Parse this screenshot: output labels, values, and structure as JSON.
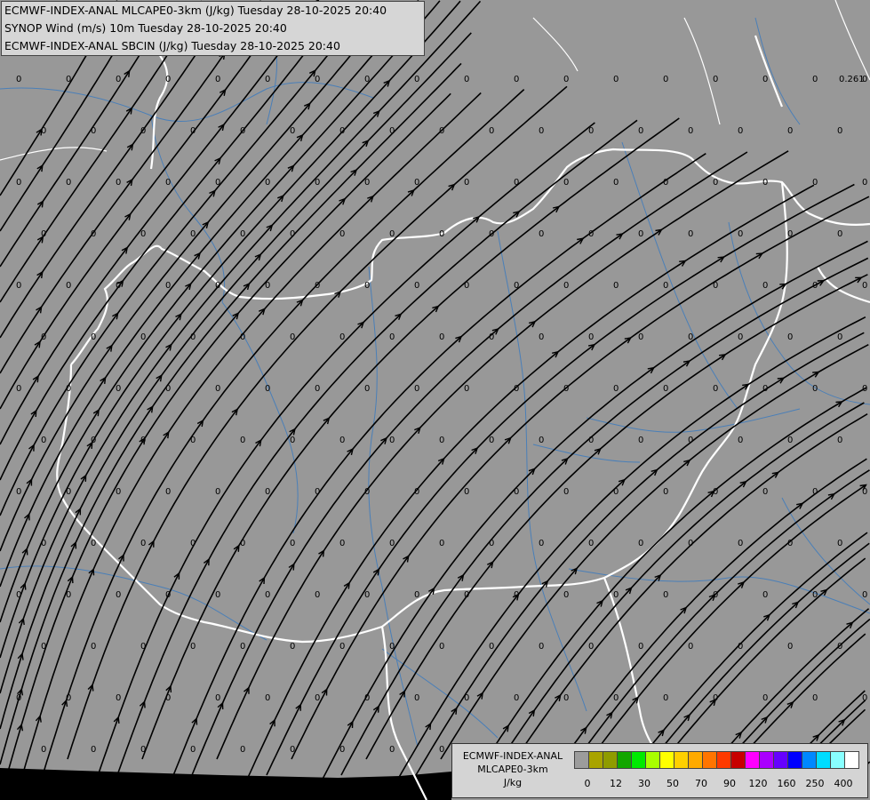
{
  "header": {
    "line1": "ECMWF-INDEX-ANAL MLCAPE0-3km (J/kg) Tuesday 28-10-2025 20:40",
    "line2": "SYNOP Wind (m/s) 10m Tuesday 28-10-2025 20:40",
    "line3": "ECMWF-INDEX-ANAL SBCIN (J/kg) Tuesday 28-10-2025 20:40"
  },
  "legend": {
    "label_line1": "ECMWF-INDEX-ANAL",
    "label_line2": "MLCAPE0-3km",
    "label_line3": "J/kg",
    "colors": [
      "#9c9c9c",
      "#a9a400",
      "#8f9c00",
      "#12a600",
      "#00ea00",
      "#a9ff00",
      "#ffff00",
      "#ffd000",
      "#ffaa00",
      "#ff7500",
      "#ff3a00",
      "#c80000",
      "#ff00ff",
      "#aa00ff",
      "#6600ff",
      "#0000ff",
      "#0088ff",
      "#00ddff",
      "#88ffff",
      "#ffffff"
    ],
    "ticks": [
      "0",
      "12",
      "30",
      "50",
      "70",
      "90",
      "120",
      "160",
      "250",
      "400"
    ]
  },
  "map": {
    "grid_value": "0",
    "special_value": "0.261",
    "background_color": "#989898",
    "border_color": "#ffffff",
    "river_color": "#4a7fb8",
    "streamline_color": "#000000"
  }
}
